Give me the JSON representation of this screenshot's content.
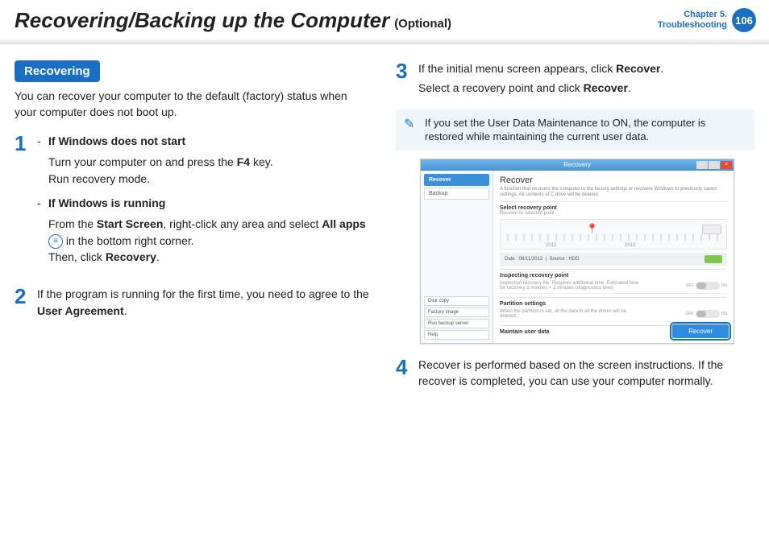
{
  "header": {
    "title": "Recovering/Backing up the Computer",
    "optional": "(Optional)",
    "chapter_line1": "Chapter 5.",
    "chapter_line2": "Troubleshooting",
    "page": "106"
  },
  "left": {
    "section_title": "Recovering",
    "intro": "You can recover your computer to the default (factory) status when your computer does not boot up.",
    "step1": {
      "num": "1",
      "case1_head": "If Windows does not start",
      "case1_line_a": "Turn your computer on and press the ",
      "case1_key": "F4",
      "case1_line_b": " key.",
      "case1_line2": "Run recovery mode.",
      "case2_head": "If Windows is running",
      "case2_line_a": "From the ",
      "case2_bold1": "Start Screen",
      "case2_line_b": ", right-click any area and select ",
      "case2_bold2": "All apps",
      "case2_line_c": " in the bottom right corner.",
      "case2_line2_a": "Then, click ",
      "case2_bold3": "Recovery",
      "case2_line2_b": "."
    },
    "step2": {
      "num": "2",
      "text_a": "If the program is running for the first time, you need to agree to the ",
      "bold": "User Agreement",
      "text_b": "."
    }
  },
  "right": {
    "step3": {
      "num": "3",
      "line1_a": "If the initial menu screen appears, click ",
      "line1_bold": "Recover",
      "line1_b": ".",
      "line2_a": "Select a recovery point and click ",
      "line2_bold": "Recover",
      "line2_b": "."
    },
    "note": "If you set the User Data Maintenance to ON, the computer is restored while maintaining the current user data.",
    "step4": {
      "num": "4",
      "text": "Recover is performed based on the screen instructions. If the recover is completed, you can use your computer normally."
    }
  },
  "shot": {
    "window_title": "Recovery",
    "side_recover": "Recover",
    "side_backup": "Backup",
    "side_diskcopy": "Disk copy",
    "side_factory": "Factory image",
    "side_runbackup": "Run backup server",
    "side_help": "Help",
    "main_title": "Recover",
    "main_desc": "A function that recovers the computer to the factory settings or recovers Windows to previously saved settings. All contents of C drive will be deleted.",
    "sec1_label": "Select recovery point",
    "sec1_sub": "Recover to selected point.",
    "year1": "2012",
    "year2": "2013",
    "info_date_label": "Date :",
    "info_date": "06/11/2012",
    "info_src_label": "Source :",
    "info_src": "HDD",
    "sec2_label": "Inspecting recovery point",
    "sec2_text": "Inspection recovery file. Requires additional time. Estimated time for recovery 2 minutes + 2 minutes (diagnostics time)",
    "sec3_label": "Partition settings",
    "sec3_text": "When the partition is set, all the data in all the drives will be deleted.",
    "sec4_label": "Maintain user data",
    "toggle_off": "OFF",
    "toggle_on": "ON",
    "recover_btn": "Recover"
  }
}
